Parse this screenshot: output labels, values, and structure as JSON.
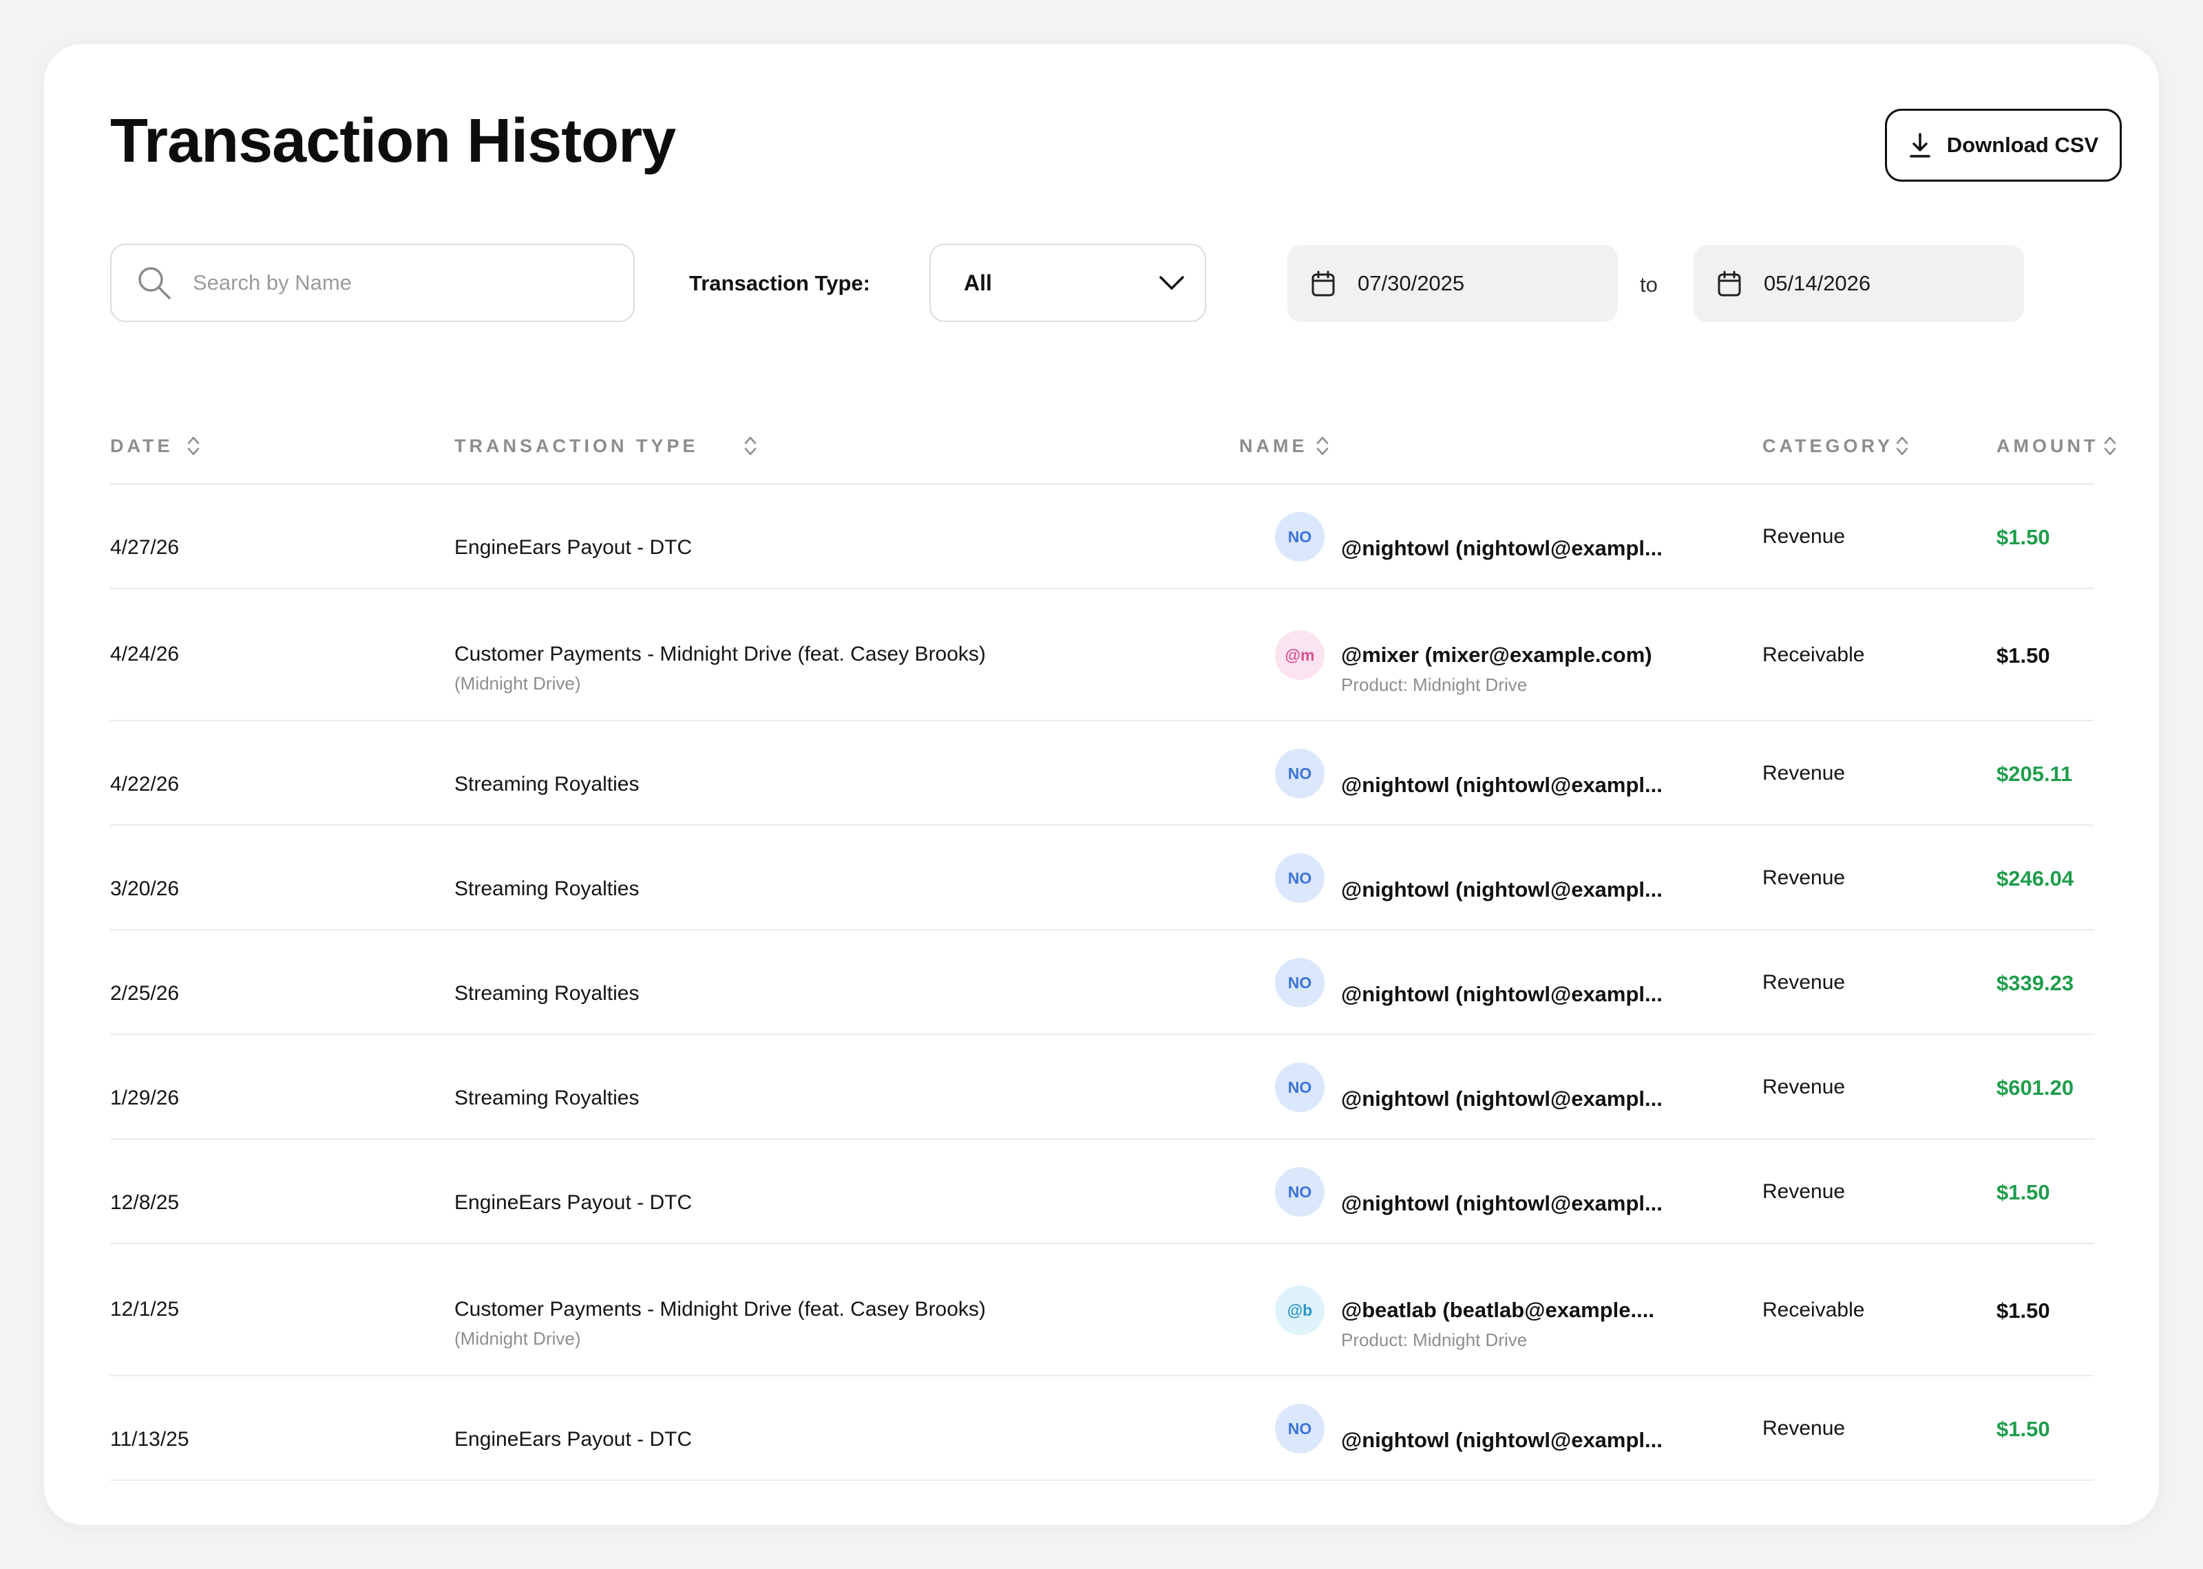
{
  "page": {
    "title": "Transaction History"
  },
  "toolbar": {
    "download_label": "Download CSV"
  },
  "filters": {
    "search_placeholder": "Search by Name",
    "type_label": "Transaction Type:",
    "type_value": "All",
    "date_from": "07/30/2025",
    "date_separator": "to",
    "date_to": "05/14/2026"
  },
  "table": {
    "columns": [
      "DATE",
      "TRANSACTION TYPE",
      "NAME",
      "CATEGORY",
      "AMOUNT"
    ],
    "rows": [
      {
        "date": "4/27/26",
        "type": "EngineEars Payout - DTC",
        "type_sub": "",
        "avatar": "NO",
        "name": "@nightowl (nightowl@exampl...",
        "name_sub": "",
        "category": "Revenue",
        "amount": "$1.50",
        "positive": true
      },
      {
        "date": "4/24/26",
        "type": "Customer Payments - Midnight Drive (feat. Casey Brooks)",
        "type_sub": "(Midnight Drive)",
        "avatar": "@m",
        "name": "@mixer (mixer@example.com)",
        "name_sub": "Product: Midnight Drive",
        "category": "Receivable",
        "amount": "$1.50",
        "positive": false
      },
      {
        "date": "4/22/26",
        "type": "Streaming Royalties",
        "type_sub": "",
        "avatar": "NO",
        "name": "@nightowl (nightowl@exampl...",
        "name_sub": "",
        "category": "Revenue",
        "amount": "$205.11",
        "positive": true
      },
      {
        "date": "3/20/26",
        "type": "Streaming Royalties",
        "type_sub": "",
        "avatar": "NO",
        "name": "@nightowl (nightowl@exampl...",
        "name_sub": "",
        "category": "Revenue",
        "amount": "$246.04",
        "positive": true
      },
      {
        "date": "2/25/26",
        "type": "Streaming Royalties",
        "type_sub": "",
        "avatar": "NO",
        "name": "@nightowl (nightowl@exampl...",
        "name_sub": "",
        "category": "Revenue",
        "amount": "$339.23",
        "positive": true
      },
      {
        "date": "1/29/26",
        "type": "Streaming Royalties",
        "type_sub": "",
        "avatar": "NO",
        "name": "@nightowl (nightowl@exampl...",
        "name_sub": "",
        "category": "Revenue",
        "amount": "$601.20",
        "positive": true
      },
      {
        "date": "12/8/25",
        "type": "EngineEars Payout - DTC",
        "type_sub": "",
        "avatar": "NO",
        "name": "@nightowl (nightowl@exampl...",
        "name_sub": "",
        "category": "Revenue",
        "amount": "$1.50",
        "positive": true
      },
      {
        "date": "12/1/25",
        "type": "Customer Payments - Midnight Drive (feat. Casey Brooks)",
        "type_sub": "(Midnight Drive)",
        "avatar": "@b",
        "name": "@beatlab (beatlab@example....",
        "name_sub": "Product: Midnight Drive",
        "category": "Receivable",
        "amount": "$1.50",
        "positive": false
      },
      {
        "date": "11/13/25",
        "type": "EngineEars Payout - DTC",
        "type_sub": "",
        "avatar": "NO",
        "name": "@nightowl (nightowl@exampl...",
        "name_sub": "",
        "category": "Revenue",
        "amount": "$1.50",
        "positive": true
      }
    ]
  },
  "colors": {
    "positive_amount": "#1f9d4c",
    "neutral_amount": "#111111",
    "avatar_NO_bg": "#dbe7fb",
    "avatar_NO_fg": "#3b74d8",
    "avatar_m_bg": "#fbe3ef",
    "avatar_m_fg": "#d6508f",
    "avatar_b_bg": "#dff3fb",
    "avatar_b_fg": "#2a95c8"
  }
}
